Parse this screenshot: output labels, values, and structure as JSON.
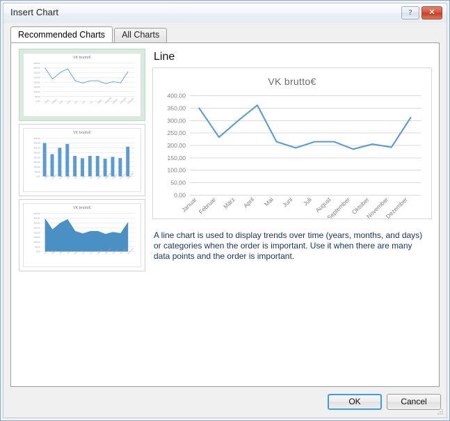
{
  "window": {
    "title": "Insert Chart",
    "help_button": "?",
    "close_button": "✕"
  },
  "tabs": [
    {
      "label": "Recommended Charts",
      "active": true
    },
    {
      "label": "All Charts",
      "active": false
    }
  ],
  "recommendations": [
    {
      "name": "line-chart-thumbnail",
      "type": "line",
      "title": "VK brutto€",
      "selected": true
    },
    {
      "name": "column-chart-thumbnail",
      "type": "bar",
      "title": "VK brutto€",
      "selected": false
    },
    {
      "name": "area-chart-thumbnail",
      "type": "area",
      "title": "VK brutto€",
      "selected": false
    }
  ],
  "preview": {
    "heading": "Line",
    "description": "A line chart is used to display trends over time (years, months, and days) or categories when the order is important. Use it when there are many data points and the order is important."
  },
  "footer": {
    "ok_label": "OK",
    "cancel_label": "Cancel"
  },
  "colors": {
    "series_blue": "#5B9BD5",
    "area_fill": "#4A90C4",
    "selection_green": "#d7ecdc",
    "gridline": "#d9d9d9",
    "axis_text": "#808080",
    "title_bar_accent": "#b8cde2",
    "close_red": "#c63f23",
    "ok_focus_blue": "#3e9de0",
    "description_text": "#16335c"
  },
  "chart_data": {
    "type": "line",
    "title": "VK brutto€",
    "xlabel": "",
    "ylabel": "",
    "categories": [
      "Januar",
      "Februar",
      "März",
      "April",
      "Mai",
      "Juni",
      "Juli",
      "August",
      "September",
      "Oktober",
      "November",
      "Dezember"
    ],
    "series": [
      {
        "name": "VK brutto€",
        "values": [
          350.0,
          233.0,
          300.0,
          362.0,
          215.0,
          190.0,
          215.0,
          215.0,
          185.0,
          205.0,
          192.0,
          312.0
        ]
      }
    ],
    "ylim": [
      0,
      400
    ],
    "ytick_step": 50,
    "ytick_labels": [
      "0,00",
      "50,00",
      "100,00",
      "150,00",
      "200,00",
      "250,00",
      "300,00",
      "350,00",
      "400,00"
    ],
    "grid": true,
    "legend": false,
    "xtick_rotation": -45
  }
}
